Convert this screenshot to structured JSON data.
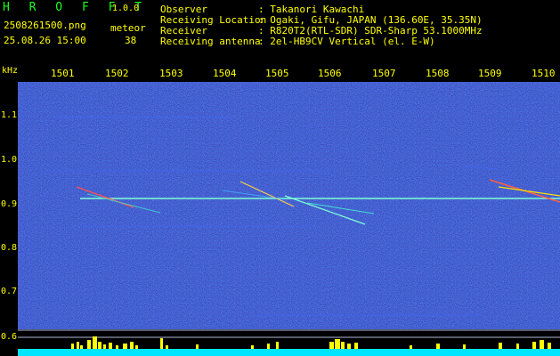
{
  "header": {
    "app_title": "H R O F F T",
    "version": "1.0.0",
    "filename": "2508261500.png",
    "datetime": "25.08.26 15:00",
    "meteor_label": "meteor",
    "meteor_count": "38",
    "rows": [
      {
        "label": "Observer",
        "colon": ":",
        "value": "Takanori Kawachi"
      },
      {
        "label": "Receiving Location",
        "colon": ":",
        "value": "Ogaki, Gifu, JAPAN (136.60E, 35.35N)"
      },
      {
        "label": "Receiver",
        "colon": ":",
        "value": "R820T2(RTL-SDR) SDR-Sharp 53.1000MHz"
      },
      {
        "label": "Receiving antenna",
        "colon": ":",
        "value": "2el-HB9CV Vertical (el. E-W)"
      }
    ]
  },
  "axis": {
    "unit": "kHz",
    "minute_ticks": [
      "1501",
      "1502",
      "1503",
      "1504",
      "1505",
      "1506",
      "1507",
      "1508",
      "1509",
      "1510"
    ],
    "freq_ticks": [
      "1.1",
      "1.0",
      "0.9",
      "0.8",
      "0.7",
      "0.6"
    ]
  },
  "colors": {
    "background": "#000000",
    "text": "#ffff00",
    "title": "#18ff18",
    "spectrogram_bg": "#0a0a8c",
    "carrier": "#7fffd4",
    "level_bar": "#ffff00",
    "baseline": "#00e5ff"
  }
}
